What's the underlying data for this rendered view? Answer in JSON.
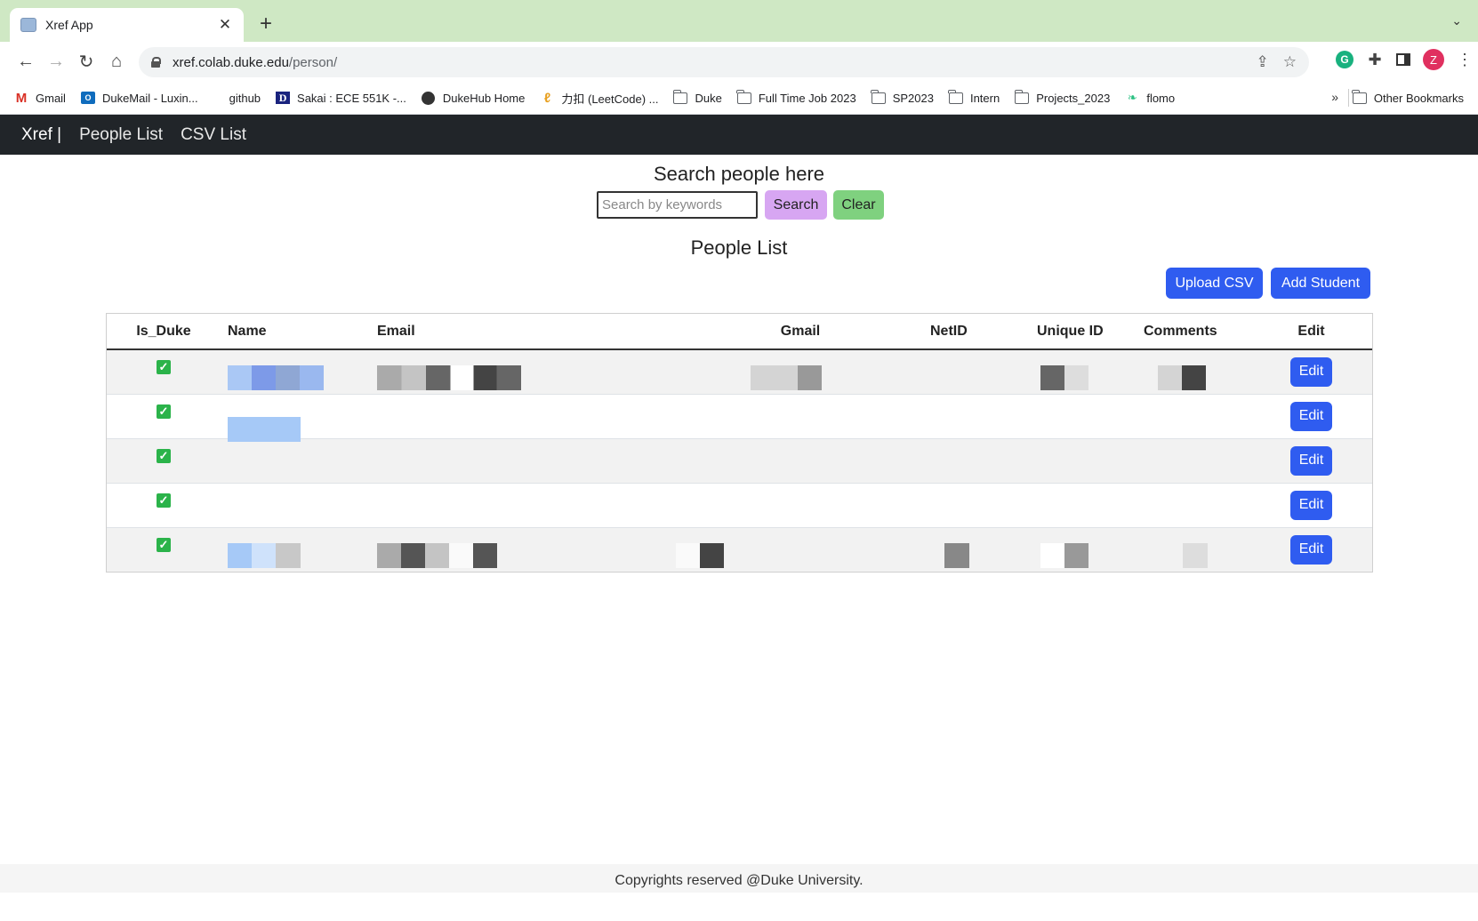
{
  "browser": {
    "tab_title": "Xref App",
    "url_host": "xref.colab.duke.edu",
    "url_path": "/person/",
    "avatar_letter": "Z",
    "bookmarks": [
      {
        "label": "Gmail",
        "icon": "gmail-icon"
      },
      {
        "label": "DukeMail - Luxin...",
        "icon": "outlook-icon"
      },
      {
        "label": "github",
        "icon": "none"
      },
      {
        "label": "Sakai : ECE 551K -...",
        "icon": "sakai-icon"
      },
      {
        "label": "DukeHub Home",
        "icon": "globe-icon"
      },
      {
        "label": "力扣 (LeetCode) ...",
        "icon": "leetcode-icon"
      },
      {
        "label": "Duke",
        "icon": "folder-icon"
      },
      {
        "label": "Full Time Job 2023",
        "icon": "folder-icon"
      },
      {
        "label": "SP2023",
        "icon": "folder-icon"
      },
      {
        "label": "Intern",
        "icon": "folder-icon"
      },
      {
        "label": "Projects_2023",
        "icon": "folder-icon"
      },
      {
        "label": "flomo",
        "icon": "flomo-icon"
      }
    ],
    "more": "»",
    "other_bookmarks": "Other Bookmarks"
  },
  "nav": {
    "brand": "Xref |",
    "links": [
      "People List",
      "CSV List"
    ]
  },
  "search": {
    "title": "Search people here",
    "placeholder": "Search by keywords",
    "search_label": "Search",
    "clear_label": "Clear"
  },
  "list": {
    "title": "People List",
    "upload_label": "Upload CSV",
    "add_label": "Add Student",
    "columns": [
      "Is_Duke",
      "Name",
      "Email",
      "Gmail",
      "NetID",
      "Unique ID",
      "Comments",
      "Edit"
    ],
    "rows": [
      {
        "is_duke": true,
        "edit_label": "Edit"
      },
      {
        "is_duke": true,
        "edit_label": "Edit"
      },
      {
        "is_duke": true,
        "edit_label": "Edit"
      },
      {
        "is_duke": true,
        "edit_label": "Edit"
      },
      {
        "is_duke": true,
        "edit_label": "Edit"
      }
    ]
  },
  "footer": {
    "text": "Copyrights reserved @Duke University."
  },
  "colors": {
    "tabstrip": "#cfe8c4",
    "navbar": "#212529",
    "primary_button": "#2f5cf0",
    "search_button": "#d7a6f2",
    "clear_button": "#7fd17f",
    "checkbox": "#2bb34a"
  }
}
